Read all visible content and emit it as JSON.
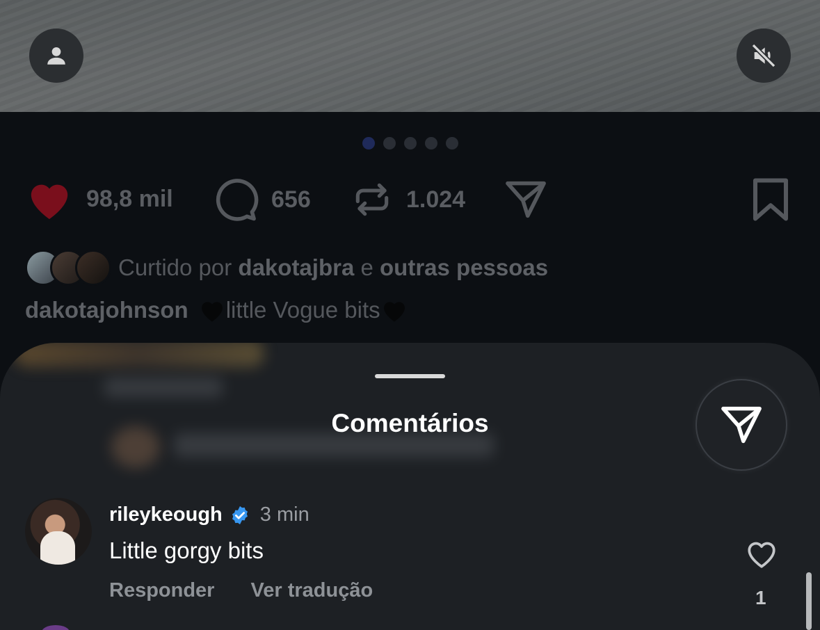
{
  "post": {
    "dots": [
      true,
      false,
      false,
      false,
      false
    ],
    "actions": {
      "likes": "98,8 mil",
      "comments": "656",
      "reposts": "1.024"
    },
    "liked_by": {
      "prefix": "Curtido por",
      "user": "dakotajbra",
      "connector": "e",
      "others": "outras pessoas"
    },
    "caption": {
      "user": "dakotajohnson",
      "text": "little Vogue bits"
    },
    "colors": {
      "like_active": "#7a0f1c"
    }
  },
  "sheet": {
    "title": "Comentários",
    "comment": {
      "user": "rileykeough",
      "time": "3 min",
      "text": "Little gorgy bits",
      "reply": "Responder",
      "translate": "Ver tradução",
      "like_count": "1"
    },
    "colors": {
      "verified": "#3897f0"
    }
  }
}
